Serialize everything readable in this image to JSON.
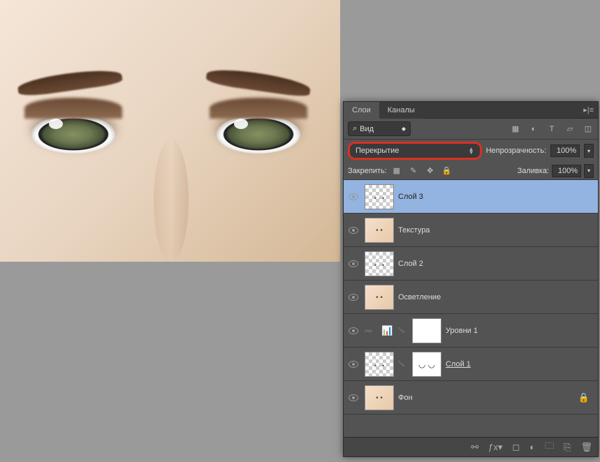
{
  "tabs": {
    "layers": "Слои",
    "channels": "Каналы"
  },
  "filter": {
    "label": "Вид",
    "search_icon": "⌕"
  },
  "blend": {
    "mode": "Перекрытие",
    "opacity_label": "Непрозрачность:",
    "opacity_value": "100%"
  },
  "lock": {
    "label": "Закрепить:",
    "fill_label": "Заливка:",
    "fill_value": "100%"
  },
  "layers": [
    {
      "name": "Слой 3",
      "type": "trans",
      "selected": true
    },
    {
      "name": "Текстура",
      "type": "face"
    },
    {
      "name": "Слой 2",
      "type": "trans"
    },
    {
      "name": "Осветление",
      "type": "face"
    },
    {
      "name": "Уровни 1",
      "type": "levels"
    },
    {
      "name": "Слой 1",
      "type": "curve",
      "underline": true
    },
    {
      "name": "Фон",
      "type": "face",
      "locked": true
    }
  ]
}
